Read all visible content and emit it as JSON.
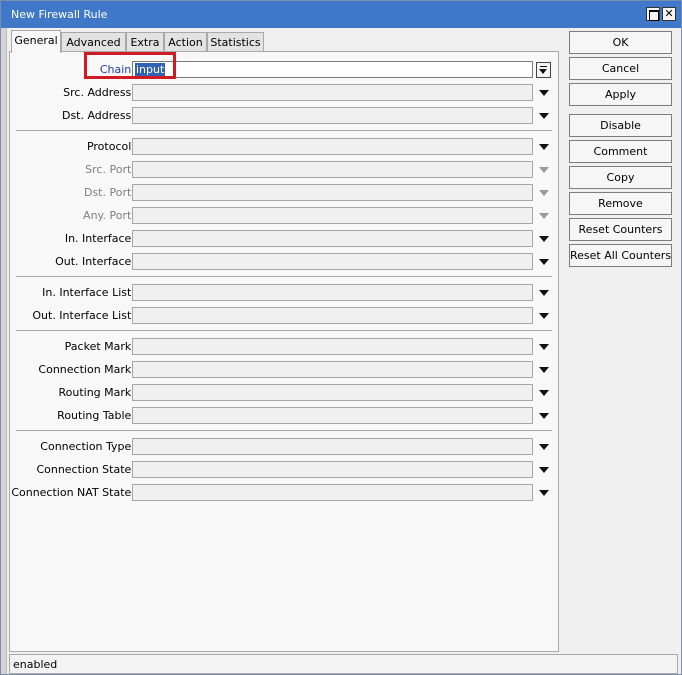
{
  "window": {
    "title": "New Firewall Rule"
  },
  "tabs": [
    {
      "label": "General",
      "active": true
    },
    {
      "label": "Advanced",
      "active": false
    },
    {
      "label": "Extra",
      "active": false
    },
    {
      "label": "Action",
      "active": false
    },
    {
      "label": "Statistics",
      "active": false
    }
  ],
  "form": {
    "chain": {
      "label": "Chain:",
      "value": "input"
    },
    "src_address": {
      "label": "Src. Address:",
      "value": ""
    },
    "dst_address": {
      "label": "Dst. Address:",
      "value": ""
    },
    "protocol": {
      "label": "Protocol:",
      "value": ""
    },
    "src_port": {
      "label": "Src. Port:",
      "value": "",
      "disabled": true
    },
    "dst_port": {
      "label": "Dst. Port:",
      "value": "",
      "disabled": true
    },
    "any_port": {
      "label": "Any. Port:",
      "value": "",
      "disabled": true
    },
    "in_interface": {
      "label": "In. Interface:",
      "value": ""
    },
    "out_interface": {
      "label": "Out. Interface:",
      "value": ""
    },
    "in_interface_list": {
      "label": "In. Interface List:",
      "value": ""
    },
    "out_interface_list": {
      "label": "Out. Interface List:",
      "value": ""
    },
    "packet_mark": {
      "label": "Packet Mark:",
      "value": ""
    },
    "connection_mark": {
      "label": "Connection Mark:",
      "value": ""
    },
    "routing_mark": {
      "label": "Routing Mark:",
      "value": ""
    },
    "routing_table": {
      "label": "Routing Table:",
      "value": ""
    },
    "connection_type": {
      "label": "Connection Type:",
      "value": ""
    },
    "connection_state": {
      "label": "Connection State:",
      "value": ""
    },
    "connection_nat_state": {
      "label": "Connection NAT State:",
      "value": ""
    }
  },
  "buttons": {
    "ok": "OK",
    "cancel": "Cancel",
    "apply": "Apply",
    "disable": "Disable",
    "comment": "Comment",
    "copy": "Copy",
    "remove": "Remove",
    "reset_counters": "Reset Counters",
    "reset_all_counters": "Reset All Counters"
  },
  "status": {
    "text": "enabled"
  },
  "colors": {
    "titlebar": "#3f78c8",
    "highlight": "#d11b24",
    "selection": "#3162b4",
    "chain_label": "#1e3ea8"
  }
}
